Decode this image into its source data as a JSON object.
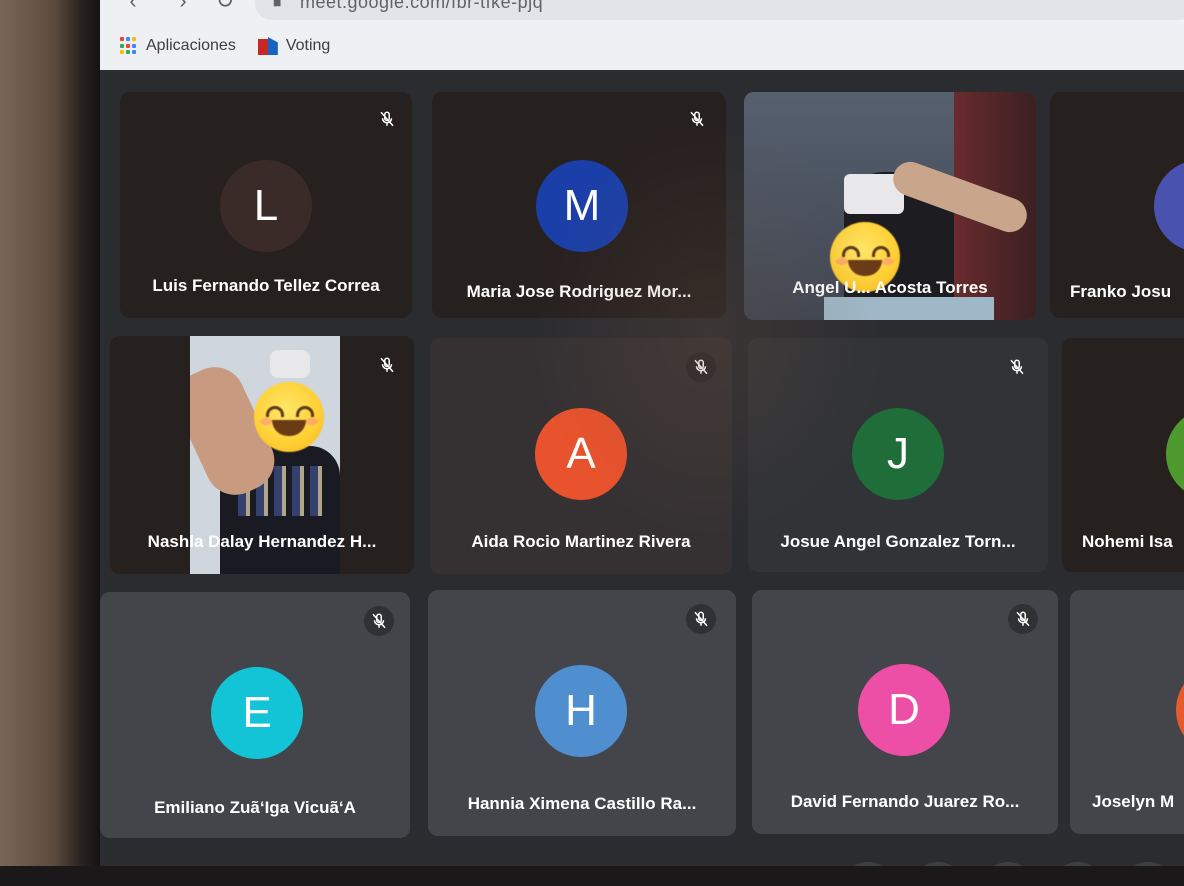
{
  "browser": {
    "url": "meet.google.com/fbr-tfke-pjq",
    "bookmarks": [
      {
        "label": "Aplicaciones",
        "icon": "apps-grid-icon"
      },
      {
        "label": "Voting",
        "icon": "voting-logo-icon"
      }
    ]
  },
  "participants": [
    {
      "name": "Luis Fernando Tellez Correa",
      "initial": "L",
      "color": "#3a2b28",
      "muted": true
    },
    {
      "name": "Maria Jose Rodriguez Mor...",
      "initial": "M",
      "color": "#1a3fa8",
      "muted": true
    },
    {
      "name": "Angel U... Acosta Torres",
      "initial": "",
      "color": "",
      "muted": false,
      "video": true
    },
    {
      "name": "Franko Josu",
      "initial": "",
      "color": "#4a52b0",
      "muted": false
    },
    {
      "name": "Nashla Dalay Hernandez H...",
      "initial": "",
      "color": "",
      "muted": true,
      "video": true
    },
    {
      "name": "Aida Rocio Martinez Rivera",
      "initial": "A",
      "color": "#e8522c",
      "muted": true
    },
    {
      "name": "Josue Angel Gonzalez Torn...",
      "initial": "J",
      "color": "#1f6e3a",
      "muted": true
    },
    {
      "name": "Nohemi Isa",
      "initial": "",
      "color": "#4e9a2e",
      "muted": false
    },
    {
      "name": "Emiliano Zuã‘Iga Vicuã‘A",
      "initial": "E",
      "color": "#12c4d6",
      "muted": true
    },
    {
      "name": "Hannia Ximena Castillo Ra...",
      "initial": "H",
      "color": "#4f8fd0",
      "muted": true
    },
    {
      "name": "David Fernando Juarez Ro...",
      "initial": "D",
      "color": "#ee4fa6",
      "muted": true
    },
    {
      "name": "Joselyn M",
      "initial": "",
      "color": "#e65a2e",
      "muted": false
    }
  ]
}
